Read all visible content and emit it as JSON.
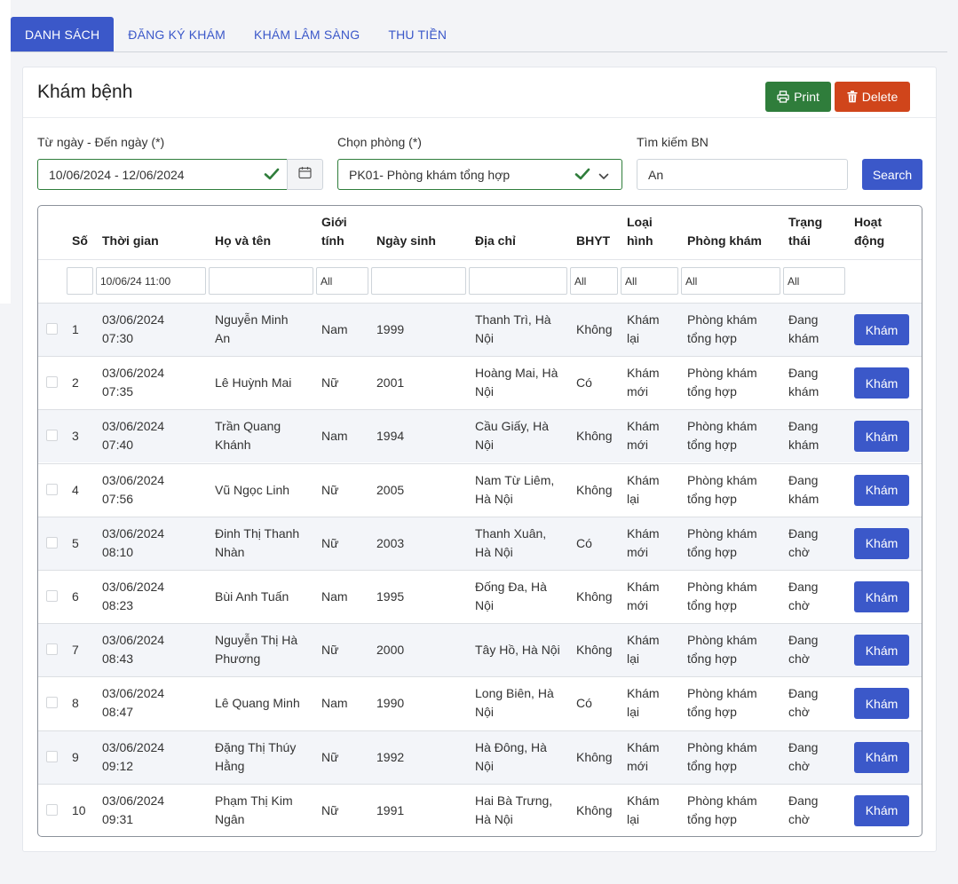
{
  "tabs": [
    "DANH SÁCH",
    "ĐĂNG KÝ KHÁM",
    "KHÁM LÂM SÀNG",
    "THU TIỀN"
  ],
  "page_title": "Khám bệnh",
  "actions": {
    "print": "Print",
    "delete": "Delete",
    "search": "Search"
  },
  "filters": {
    "date_label": "Từ ngày - Đến ngày (*)",
    "date_value": "10/06/2024 - 12/06/2024",
    "room_label": "Chọn phòng (*)",
    "room_value": "PK01- Phòng khám tổng hợp",
    "search_label": "Tìm kiếm BN",
    "search_value": "An"
  },
  "columns": {
    "so": "Số",
    "thoigian": "Thời gian",
    "hoten": "Họ và tên",
    "gioitinh_1": "Giới",
    "gioitinh_2": "tính",
    "ngaysinh": "Ngày sinh",
    "diachi": "Địa chỉ",
    "bhyt": "BHYT",
    "loaihinh_1": "Loại",
    "loaihinh_2": "hình",
    "phongkham": "Phòng khám",
    "trangthai_1": "Trạng",
    "trangthai_2": "thái",
    "hoatdong_1": "Hoạt",
    "hoatdong_2": "động"
  },
  "column_filters": {
    "time": "10/06/24 11:00",
    "gender": "All",
    "bhyt": "All",
    "type": "All",
    "room": "All",
    "status": "All"
  },
  "row_action": "Khám",
  "rows": [
    {
      "no": "1",
      "date": "03/06/2024",
      "time": "07:30",
      "name1": "Nguyễn Minh",
      "name2": "An",
      "gender": "Nam",
      "birth": "1999",
      "addr1": "Thanh Trì, Hà",
      "addr2": "Nội",
      "bhyt": "Không",
      "type1": "Khám",
      "type2": "lại",
      "room1": "Phòng khám",
      "room2": "tổng hợp",
      "status1": "Đang",
      "status2": "khám"
    },
    {
      "no": "2",
      "date": "03/06/2024",
      "time": "07:35",
      "name1": "Lê Huỳnh Mai",
      "name2": "",
      "gender": "Nữ",
      "birth": "2001",
      "addr1": "Hoàng Mai, Hà",
      "addr2": "Nội",
      "bhyt": "Có",
      "type1": "Khám",
      "type2": "mới",
      "room1": "Phòng khám",
      "room2": "tổng hợp",
      "status1": "Đang",
      "status2": "khám"
    },
    {
      "no": "3",
      "date": "03/06/2024",
      "time": "07:40",
      "name1": "Trần Quang",
      "name2": "Khánh",
      "gender": "Nam",
      "birth": "1994",
      "addr1": "Cầu Giấy, Hà",
      "addr2": "Nội",
      "bhyt": "Không",
      "type1": "Khám",
      "type2": "mới",
      "room1": "Phòng khám",
      "room2": "tổng hợp",
      "status1": "Đang",
      "status2": "khám"
    },
    {
      "no": "4",
      "date": "03/06/2024",
      "time": "07:56",
      "name1": "Vũ Ngọc Linh",
      "name2": "",
      "gender": "Nữ",
      "birth": "2005",
      "addr1": "Nam Từ Liêm,",
      "addr2": "Hà Nội",
      "bhyt": "Không",
      "type1": "Khám",
      "type2": "lại",
      "room1": "Phòng khám",
      "room2": "tổng hợp",
      "status1": "Đang",
      "status2": "khám"
    },
    {
      "no": "5",
      "date": "03/06/2024",
      "time": "08:10",
      "name1": "Đinh Thị Thanh",
      "name2": "Nhàn",
      "gender": "Nữ",
      "birth": "2003",
      "addr1": "Thanh Xuân,",
      "addr2": "Hà Nội",
      "bhyt": "Có",
      "type1": "Khám",
      "type2": "mới",
      "room1": "Phòng khám",
      "room2": "tổng hợp",
      "status1": "Đang",
      "status2": "chờ"
    },
    {
      "no": "6",
      "date": "03/06/2024",
      "time": "08:23",
      "name1": "Bùi Anh Tuấn",
      "name2": "",
      "gender": "Nam",
      "birth": "1995",
      "addr1": "Đống Đa, Hà",
      "addr2": "Nội",
      "bhyt": "Không",
      "type1": "Khám",
      "type2": "mới",
      "room1": "Phòng khám",
      "room2": "tổng hợp",
      "status1": "Đang",
      "status2": "chờ"
    },
    {
      "no": "7",
      "date": "03/06/2024",
      "time": "08:43",
      "name1": "Nguyễn Thị Hà",
      "name2": "Phương",
      "gender": "Nữ",
      "birth": "2000",
      "addr1": "Tây Hồ, Hà Nội",
      "addr2": "",
      "bhyt": "Không",
      "type1": "Khám",
      "type2": "lại",
      "room1": "Phòng khám",
      "room2": "tổng hợp",
      "status1": "Đang",
      "status2": "chờ"
    },
    {
      "no": "8",
      "date": "03/06/2024",
      "time": "08:47",
      "name1": "Lê Quang Minh",
      "name2": "",
      "gender": "Nam",
      "birth": "1990",
      "addr1": "Long Biên, Hà",
      "addr2": "Nội",
      "bhyt": "Có",
      "type1": "Khám",
      "type2": "lại",
      "room1": "Phòng khám",
      "room2": "tổng hợp",
      "status1": "Đang",
      "status2": "chờ"
    },
    {
      "no": "9",
      "date": "03/06/2024",
      "time": "09:12",
      "name1": "Đặng Thị Thúy",
      "name2": "Hằng",
      "gender": "Nữ",
      "birth": "1992",
      "addr1": "Hà Đông, Hà",
      "addr2": "Nội",
      "bhyt": "Không",
      "type1": "Khám",
      "type2": "mới",
      "room1": "Phòng khám",
      "room2": "tổng hợp",
      "status1": "Đang",
      "status2": "chờ"
    },
    {
      "no": "10",
      "date": "03/06/2024",
      "time": "09:31",
      "name1": "Phạm Thị Kim",
      "name2": "Ngân",
      "gender": "Nữ",
      "birth": "1991",
      "addr1": "Hai Bà Trưng,",
      "addr2": "Hà Nội",
      "bhyt": "Không",
      "type1": "Khám",
      "type2": "lại",
      "room1": "Phòng khám",
      "room2": "tổng hợp",
      "status1": "Đang",
      "status2": "chờ"
    }
  ]
}
